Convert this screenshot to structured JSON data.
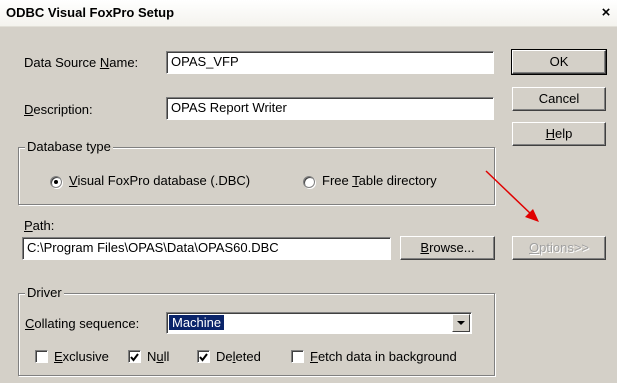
{
  "window": {
    "title": "ODBC Visual FoxPro Setup",
    "close_glyph": "×"
  },
  "data_source": {
    "label_pre": "Data Source ",
    "label_key": "N",
    "label_post": "ame:",
    "value": "OPAS_VFP"
  },
  "description": {
    "label_pre": "",
    "label_key": "D",
    "label_post": "escription:",
    "value": "OPAS Report Writer"
  },
  "database_type": {
    "legend": "Database type",
    "options": [
      {
        "pre": "",
        "key": "V",
        "post": "isual FoxPro database (.DBC)",
        "selected": true
      },
      {
        "pre": "Free ",
        "key": "T",
        "post": "able directory",
        "selected": false
      }
    ]
  },
  "path": {
    "label_pre": "",
    "label_key": "P",
    "label_post": "ath:",
    "value": "C:\\Program Files\\OPAS\\Data\\OPAS60.DBC"
  },
  "buttons": {
    "ok": "OK",
    "cancel": "Cancel",
    "help_key": "H",
    "help_post": "elp",
    "browse_key": "B",
    "browse_post": "rowse...",
    "options_key": "O",
    "options_post": "ptions>>"
  },
  "driver": {
    "legend": "Driver",
    "collating_pre": "",
    "collating_key": "C",
    "collating_post": "ollating sequence:",
    "collating_value": "Machine",
    "checkboxes": [
      {
        "pre": "",
        "key": "E",
        "post": "xclusive",
        "checked": false
      },
      {
        "pre": "N",
        "key": "u",
        "post": "ll",
        "checked": true
      },
      {
        "pre": "De",
        "key": "l",
        "post": "eted",
        "checked": true
      },
      {
        "pre": "",
        "key": "F",
        "post": "etch data in background",
        "checked": false
      }
    ]
  },
  "annotation": {
    "arrow_color": "#e00000"
  }
}
